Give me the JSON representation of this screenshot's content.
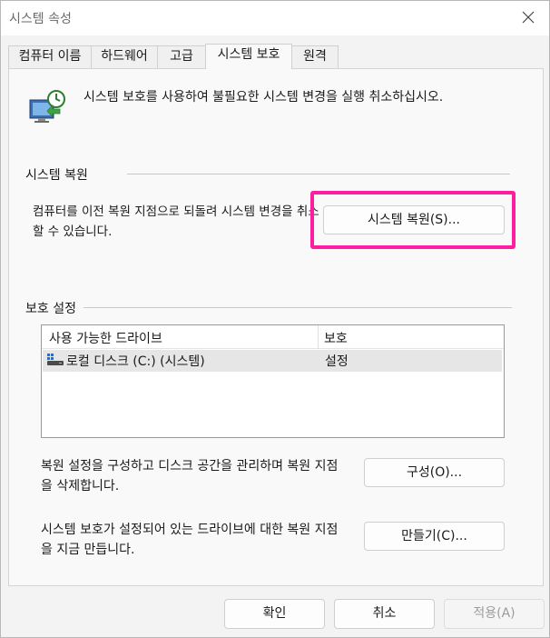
{
  "window": {
    "title": "시스템 속성"
  },
  "tabs": [
    {
      "label": "컴퓨터 이름"
    },
    {
      "label": "하드웨어"
    },
    {
      "label": "고급"
    },
    {
      "label": "시스템 보호",
      "active": true
    },
    {
      "label": "원격"
    }
  ],
  "intro": {
    "text": "시스템 보호를 사용하여 불필요한 시스템 변경을 실행 취소하십시오."
  },
  "restore": {
    "group_label": "시스템 복원",
    "description": "컴퓨터를 이전 복원 지점으로 되돌려 시스템 변경을 취소할 수 있습니다.",
    "button_label": "시스템 복원(S)..."
  },
  "protection": {
    "group_label": "보호 설정",
    "columns": [
      "사용 가능한 드라이브",
      "보호"
    ],
    "drives": [
      {
        "name": "로컬 디스크 (C:) (시스템)",
        "protection": "설정"
      }
    ]
  },
  "configure": {
    "description": "복원 설정을 구성하고 디스크 공간을 관리하며 복원 지점을 삭제합니다.",
    "button_label": "구성(O)..."
  },
  "create": {
    "description": "시스템 보호가 설정되어 있는 드라이브에 대한 복원 지점을 지금 만듭니다.",
    "button_label": "만들기(C)..."
  },
  "footer": {
    "ok_label": "확인",
    "cancel_label": "취소",
    "apply_label": "적용(A)"
  },
  "colors": {
    "highlight": "#ff1ea0"
  }
}
